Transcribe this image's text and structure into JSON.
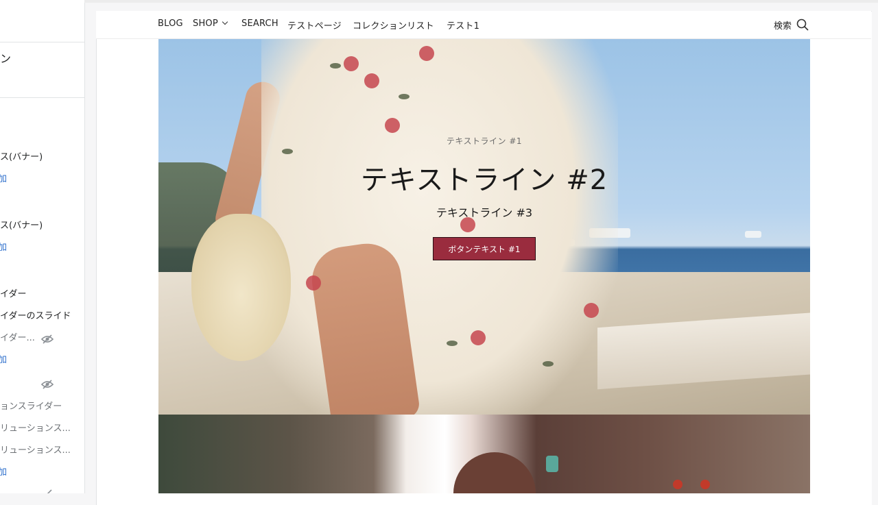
{
  "sidebar": {
    "title": "ン",
    "items": [
      {
        "text": "ス(バナー)",
        "kind": "item"
      },
      {
        "text": "加",
        "kind": "add"
      },
      {
        "text": "ス(バナー)",
        "kind": "item"
      },
      {
        "text": "加",
        "kind": "add"
      },
      {
        "text": "イダー",
        "kind": "item"
      },
      {
        "text": "イダーのスライド",
        "kind": "item"
      },
      {
        "text": "イダー...",
        "kind": "hidden"
      },
      {
        "text": "加",
        "kind": "add"
      },
      {
        "text": "",
        "kind": "hidden"
      },
      {
        "text": "ョンスライダー",
        "kind": "muted"
      },
      {
        "text": "リューションス...",
        "kind": "muted"
      },
      {
        "text": "リューションス...",
        "kind": "muted"
      },
      {
        "text": "加",
        "kind": "add"
      }
    ]
  },
  "nav": {
    "links": [
      "BLOG",
      "SHOP",
      "SEARCH",
      "テストページ",
      "コレクションリスト",
      "テスト1"
    ],
    "search_label": "検索"
  },
  "hero": {
    "line1": "テキストライン #1",
    "line2": "テキストライン #2",
    "line3": "テキストライン #3",
    "button": "ボタンテキスト #1",
    "button_color": "#9a2c3e"
  },
  "icons": {
    "search": "search-icon",
    "chevron": "chevron-down-icon",
    "hidden": "eye-slash-icon"
  }
}
